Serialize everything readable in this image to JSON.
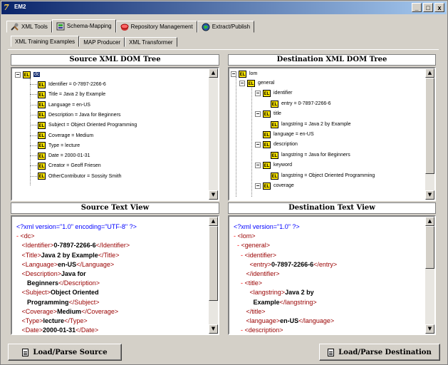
{
  "window": {
    "title": "EM2",
    "minimize": "_",
    "restore": "□",
    "close": "x"
  },
  "main_tabs": [
    {
      "label": "XML Tools",
      "icon": "tools-icon"
    },
    {
      "label": "Schema-Mapping",
      "icon": "schema-icon"
    },
    {
      "label": "Repository Management",
      "icon": "repository-icon"
    },
    {
      "label": "Extract/Publish",
      "icon": "globe-icon"
    }
  ],
  "sub_tabs": [
    "XML Training Examples",
    "MAP Producer",
    "XML Transformer"
  ],
  "source_tree": {
    "header": "Source XML DOM Tree",
    "root": "dc",
    "nodes": [
      "Identifier = 0-7897-2266-6",
      "Title = Java 2 by Example",
      "Language = en-US",
      "Description = Java for Beginners",
      "Subject = Object Oriented Programming",
      "Coverage = Medium",
      "Type = lecture",
      "Date = 2000-01-31",
      "Creator = Geoff Friesen",
      "OtherContributor = Sossity Smith"
    ]
  },
  "dest_tree": {
    "header": "Destination XML DOM Tree",
    "root": "lom",
    "general": "general",
    "identifier": "identifier",
    "entry": "entry = 0-7897-2266-6",
    "title": "title",
    "title_langstring": "langstring = Java 2 by Example",
    "language": "language = en-US",
    "description": "description",
    "desc_langstring": "langstring = Java for Beginners",
    "keyword": "keyword",
    "kw_langstring": "langstring = Object Oriented Programming",
    "coverage": "coverage"
  },
  "source_text": {
    "header": "Source Text View",
    "decl": "<?xml version=\"1.0\" encoding=\"UTF-8\" ?>",
    "root_open": "<dc>",
    "identifier": "0-7897-2266-6",
    "title": "Java 2 by Example",
    "language": "en-US",
    "description_1": "Java for",
    "description_2": "Beginners",
    "subject_1": "Object Oriented",
    "subject_2": "Programming",
    "coverage": "Medium",
    "type": "lecture",
    "date": "2000-01-31"
  },
  "dest_text": {
    "header": "Destination Text View",
    "decl": "<?xml version=\"1.0\" ?>",
    "entry": "0-7897-2266-6",
    "title_1": "Java 2 by",
    "title_2": "Example",
    "language": "en-US"
  },
  "buttons": {
    "load_source": "Load/Parse Source",
    "load_dest": "Load/Parse Destination"
  }
}
